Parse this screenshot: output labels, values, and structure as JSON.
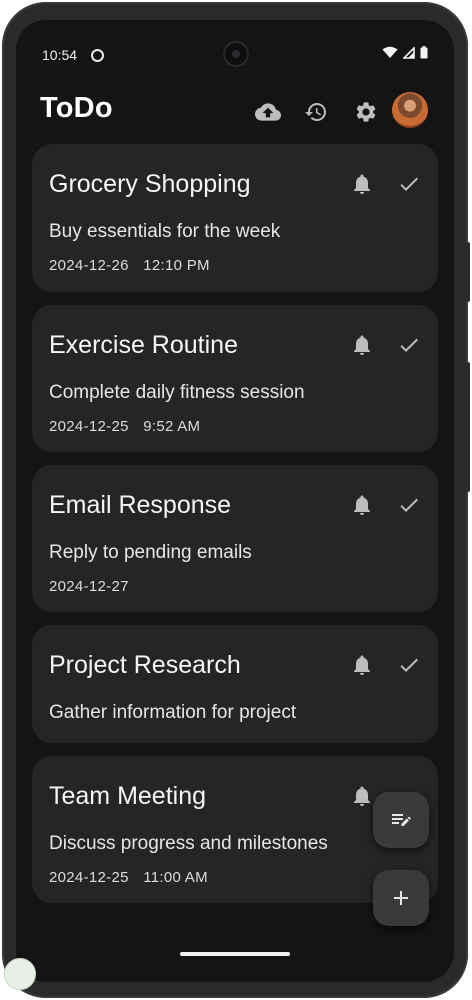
{
  "status_bar": {
    "time": "10:54"
  },
  "app": {
    "title": "ToDo"
  },
  "tasks": [
    {
      "title": "Grocery Shopping",
      "description": "Buy essentials for the week",
      "date": "2024-12-26",
      "time": "12:10 PM"
    },
    {
      "title": "Exercise Routine",
      "description": "Complete daily fitness session",
      "date": "2024-12-25",
      "time": "9:52 AM"
    },
    {
      "title": "Email Response",
      "description": "Reply to pending emails",
      "date": "2024-12-27",
      "time": ""
    },
    {
      "title": "Project Research",
      "description": "Gather information for project",
      "date": "",
      "time": ""
    },
    {
      "title": "Team Meeting",
      "description": "Discuss progress and milestones",
      "date": "2024-12-25",
      "time": "11:00 AM"
    }
  ],
  "icons": {
    "toolbar": [
      "cloud-upload-icon",
      "restore-icon",
      "settings-icon",
      "avatar"
    ],
    "task_actions": [
      "bell-icon",
      "check-icon"
    ],
    "fabs": [
      "edit-note-icon",
      "plus-icon"
    ]
  },
  "colors": {
    "background": "#141414",
    "card": "#252525",
    "fab": "#3a3a3a",
    "icon": "#bdbdbd"
  }
}
